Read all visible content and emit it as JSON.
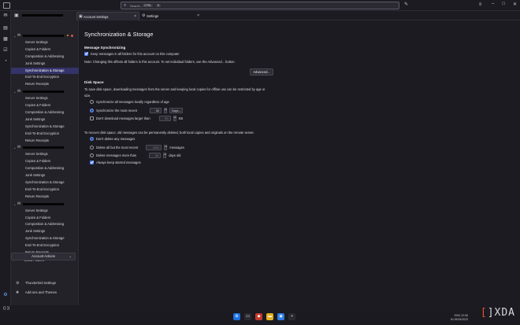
{
  "search": {
    "placeholder": "Search...",
    "shortcut_mod": "CTRL",
    "shortcut_key": "K"
  },
  "sidebar": {
    "accounts": [
      {
        "items": [
          "Server Settings",
          "Copies & Folders",
          "Composition & Addressing",
          "Junk Settings",
          "Synchronization & Storage",
          "End-To-End Encryption",
          "Return Receipts"
        ]
      },
      {
        "items": [
          "Server Settings",
          "Copies & Folders",
          "Composition & Addressing",
          "Junk Settings",
          "Synchronization & Storage",
          "End-To-End Encryption",
          "Return Receipts"
        ]
      },
      {
        "items": [
          "Server Settings",
          "Copies & Folders",
          "Composition & Addressing",
          "Junk Settings",
          "Synchronization & Storage",
          "End-To-End Encryption",
          "Return Receipts"
        ]
      },
      {
        "items": [
          "Server Settings",
          "Copies & Folders",
          "Composition & Addressing",
          "Junk Settings",
          "Synchronization & Storage",
          "End-To-End Encryption",
          "Return Receipts"
        ]
      }
    ],
    "local_folders": "Local Folders",
    "account_actions": "Account Actions",
    "thunderbird_settings": "Thunderbird Settings",
    "addons_themes": "Add-ons and Themes"
  },
  "tabs": [
    {
      "label": "Account Settings"
    },
    {
      "label": "Settings"
    }
  ],
  "page": {
    "title": "Synchronization & Storage",
    "msg_sync_heading": "Message Synchronizing",
    "keep_messages": "Keep messages in all folders for this account on this computer",
    "note": "Note: Changing this affects all folders in this account. To set individual folders, use the Advanced... button.",
    "advanced_btn": "Advanced...",
    "disk_heading": "Disk Space",
    "disk_desc": "To save disk space, downloading messages from the server and keeping local copies for offline use can be restricted by age or",
    "disk_desc2": "size.",
    "sync_all": "Synchronize all messages locally regardless of age",
    "sync_recent": "Synchronize the most recent",
    "sync_recent_value": "30",
    "sync_recent_unit": "Days",
    "dont_download": "Don't download messages larger than",
    "dont_download_value": "50",
    "dont_download_unit": "KB",
    "recover_desc": "To recover disk space, old messages can be permanently deleted, both local copies and originals on the remote server.",
    "dont_delete": "Don't delete any messages",
    "delete_all_but": "Delete all but the most recent",
    "delete_all_but_value": "2000",
    "delete_all_but_unit": "messages",
    "delete_older": "Delete messages more than",
    "delete_older_value": "30",
    "delete_older_unit": "days old",
    "keep_starred": "Always keep starred messages"
  },
  "tray": {
    "lang": "ENG",
    "region": "IN",
    "time": "22:06",
    "date": "26/09/2023"
  },
  "watermark": {
    "bracket_left": "[",
    "bracket_right": "]",
    "text": "XDA"
  }
}
